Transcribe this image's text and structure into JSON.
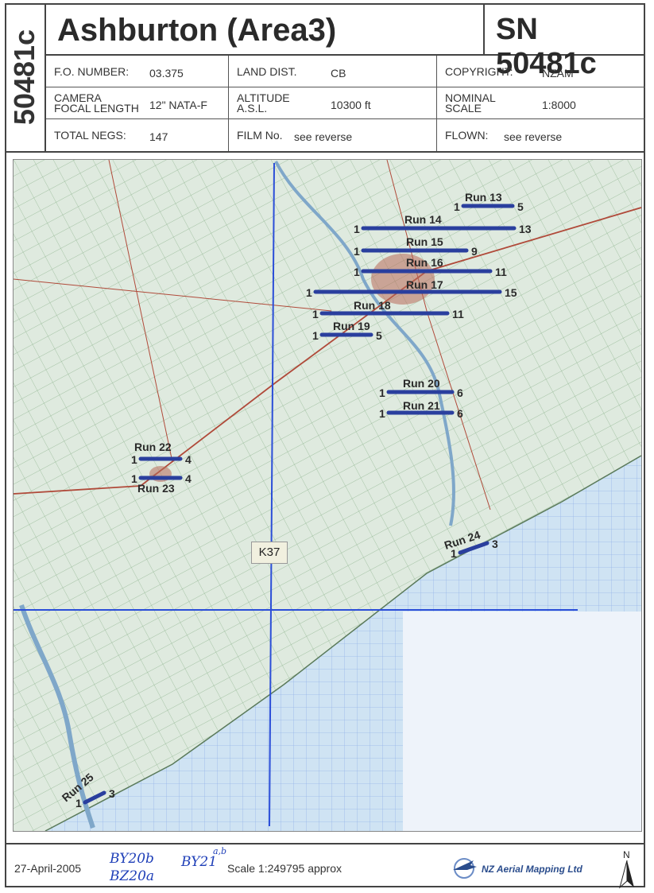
{
  "header": {
    "vertical_code": "50481c",
    "title": "Ashburton (Area3)",
    "sn": "SN 50481c",
    "fields": {
      "fo_number_label": "F.O. NUMBER:",
      "fo_number_value": "03.375",
      "land_dist_label": "LAND DIST.",
      "land_dist_value": "CB",
      "copyright_label": "COPYRIGHT:",
      "copyright_value": "NZAM",
      "camera_label_1": "CAMERA",
      "camera_label_2": "FOCAL LENGTH",
      "camera_value": "12\" NATA-F",
      "altitude_label_1": "ALTITUDE",
      "altitude_label_2": "A.S.L.",
      "altitude_value": "10300 ft",
      "nominal_label_1": "NOMINAL",
      "nominal_label_2": "SCALE",
      "nominal_value": "1:8000",
      "total_negs_label": "TOTAL NEGS:",
      "total_negs_value": "147",
      "film_label": "FILM No.",
      "film_value": "see reverse",
      "flown_label": "FLOWN:",
      "flown_value": "see reverse"
    }
  },
  "map": {
    "sheet_label": "K37",
    "colors": {
      "land": "#dfeadf",
      "sea": "#cfe3f3",
      "run_line": "#2a3f9e",
      "road": "#b04a3a",
      "river": "#7fa7c9",
      "grid": "#2b4ed8",
      "town": "#b86a5a"
    },
    "runs": [
      {
        "name": "Run 13",
        "start": "1",
        "end": "5"
      },
      {
        "name": "Run 14",
        "start": "1",
        "end": "13"
      },
      {
        "name": "Run 15",
        "start": "1",
        "end": "9"
      },
      {
        "name": "Run 16",
        "start": "1",
        "end": "11"
      },
      {
        "name": "Run 17",
        "start": "1",
        "end": "15"
      },
      {
        "name": "Run 18",
        "start": "1",
        "end": "11"
      },
      {
        "name": "Run 19",
        "start": "1",
        "end": "5"
      },
      {
        "name": "Run 20",
        "start": "1",
        "end": "6"
      },
      {
        "name": "Run 21",
        "start": "1",
        "end": "6"
      },
      {
        "name": "Run 22",
        "start": "1",
        "end": "4"
      },
      {
        "name": "Run 23",
        "start": "1",
        "end": "4"
      },
      {
        "name": "Run 24",
        "start": "1",
        "end": "3"
      },
      {
        "name": "Run 25",
        "start": "1",
        "end": "3"
      }
    ]
  },
  "footer": {
    "date": "27-April-2005",
    "handwriting_1": "BY20b",
    "handwriting_2": "BZ20a",
    "handwriting_3": "BY21",
    "handwriting_sup": "a,b",
    "scale": "Scale  1:249795 approx",
    "logo_text": "NZ Aerial Mapping Ltd",
    "north": "N"
  }
}
